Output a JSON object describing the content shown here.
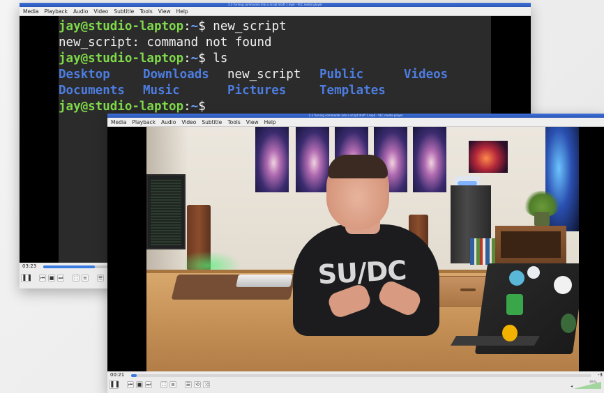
{
  "back_window": {
    "title": "2.3 Turning commands into a script draft 1.mp4 - VLC media player",
    "menu": [
      "Media",
      "Playback",
      "Audio",
      "Video",
      "Subtitle",
      "Tools",
      "View",
      "Help"
    ],
    "terminal": {
      "user_host": "jay@studio-laptop",
      "sep": ":",
      "path": "~",
      "prompt_symbol": "$",
      "cmd1": " new_script",
      "error": "new_script: command not found",
      "cmd2": " ls",
      "ls_rows": [
        [
          "Desktop",
          "Downloads",
          "new_script",
          "Public",
          "Videos"
        ],
        [
          "Documents",
          "Music",
          "Pictures",
          "Templates"
        ]
      ]
    },
    "time_elapsed": "03:23",
    "progress": 0.78
  },
  "front_window": {
    "title": "2.3 Turning commands into a script draft 1.mp4 - VLC media player",
    "menu": [
      "Media",
      "Playback",
      "Audio",
      "Video",
      "Subtitle",
      "Tools",
      "View",
      "Help"
    ],
    "time_elapsed": "00:21",
    "time_remaining": "-3",
    "progress": 0.012,
    "shirt_text": "SU/DC",
    "volume_label": "35%"
  },
  "controls": {
    "pause_icon": "pause-icon",
    "prev_icon": "skip-back-icon",
    "stop_icon": "stop-icon",
    "next_icon": "skip-forward-icon",
    "fullscreen_icon": "fullscreen-icon",
    "ext_icon": "extended-settings-icon",
    "playlist_icon": "playlist-icon",
    "loop_icon": "loop-icon",
    "shuffle_icon": "shuffle-icon"
  }
}
